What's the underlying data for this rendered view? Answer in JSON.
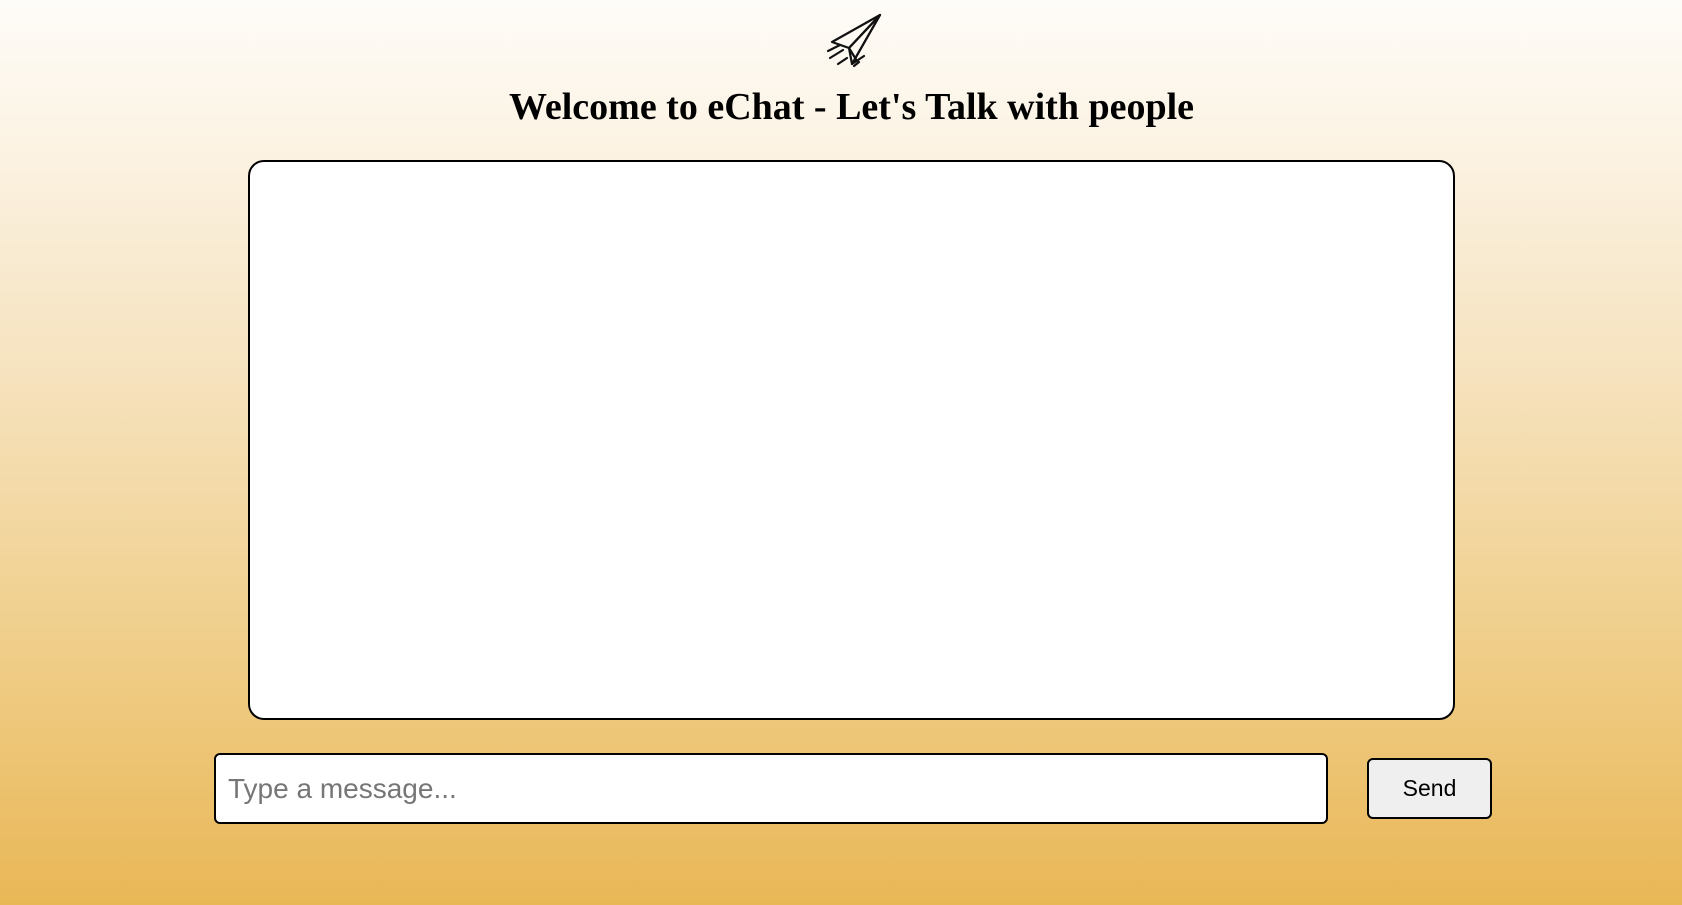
{
  "header": {
    "logo_icon": "paper-plane-icon",
    "title": "Welcome to eChat - Let's Talk with people"
  },
  "chat": {
    "messages": []
  },
  "composer": {
    "input_value": "",
    "placeholder": "Type a message...",
    "send_label": "Send"
  },
  "colors": {
    "background_top": "#fefcf8",
    "background_bottom": "#e9b756",
    "button_background": "#efefef",
    "border": "#000000"
  }
}
